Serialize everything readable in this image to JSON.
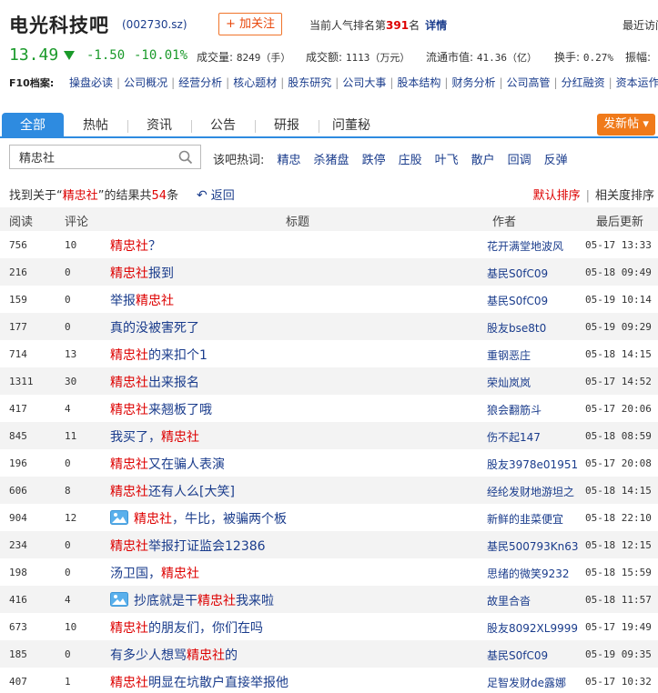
{
  "header": {
    "stock_name": "电光科技吧",
    "stock_code": "(002730.sz)",
    "follow_label": "+ 加关注",
    "rank_prefix": "当前人气排名第",
    "rank_value": "391",
    "rank_suffix": "名",
    "detail_label": "详情",
    "recent_label": "最近访问"
  },
  "quote": {
    "price": "13.49",
    "change": "-1.50",
    "change_pct": "-10.01%",
    "volume_label": "成交量:",
    "volume_value": "8249（手）",
    "turnover_label": "成交额:",
    "turnover_value": "1113（万元）",
    "float_cap_label": "流通市值:",
    "float_cap_value": "41.36（亿）",
    "turnover_rate_label": "换手:",
    "turnover_rate_value": "0.27%",
    "amplitude_label": "振幅:"
  },
  "f10": {
    "label": "F10档案:",
    "links": [
      "操盘必读",
      "公司概况",
      "经营分析",
      "核心题材",
      "股东研究",
      "公司大事",
      "股本结构",
      "财务分析",
      "公司高管",
      "分红融资",
      "资本运作"
    ]
  },
  "tabs": [
    "全部",
    "热帖",
    "资讯",
    "公告",
    "研报",
    "问董秘"
  ],
  "post_button": "发新帖",
  "search": {
    "value": "精忠社",
    "hot_label": "该吧热词:",
    "hot_words": [
      "精忠",
      "杀猪盘",
      "跌停",
      "庄股",
      "叶飞",
      "散户",
      "回调",
      "反弹"
    ]
  },
  "result": {
    "prefix": "找到关于“",
    "keyword": "精忠社",
    "middle": "”的结果共",
    "count": "54",
    "suffix": "条",
    "back_label": "返回",
    "sort_default": "默认排序",
    "sort_relevance": "相关度排序"
  },
  "columns": {
    "read": "阅读",
    "comment": "评论",
    "title": "标题",
    "author": "作者",
    "updated": "最后更新"
  },
  "posts": [
    {
      "read": "756",
      "comment": "10",
      "pre": "",
      "hl": "精忠社",
      "post": "？",
      "image": false,
      "author": "花开满堂地波风",
      "time": "05-17 13:33"
    },
    {
      "read": "216",
      "comment": "0",
      "pre": "",
      "hl": "精忠社",
      "post": "报到",
      "image": false,
      "author": "基民S0fC09",
      "time": "05-18 09:49"
    },
    {
      "read": "159",
      "comment": "0",
      "pre": "举报",
      "hl": "精忠社",
      "post": "",
      "image": false,
      "author": "基民S0fC09",
      "time": "05-19 10:14"
    },
    {
      "read": "177",
      "comment": "0",
      "pre": "真的没被害死了",
      "hl": "",
      "post": "",
      "image": false,
      "author": "股友bse8t0",
      "time": "05-19 09:29"
    },
    {
      "read": "714",
      "comment": "13",
      "pre": "",
      "hl": "精忠社",
      "post": "的来扣个1",
      "image": false,
      "author": "重钢恶庄",
      "time": "05-18 14:15"
    },
    {
      "read": "1311",
      "comment": "30",
      "pre": "",
      "hl": "精忠社",
      "post": "出来报名",
      "image": false,
      "author": "荣灿岚岚",
      "time": "05-17 14:52"
    },
    {
      "read": "417",
      "comment": "4",
      "pre": "",
      "hl": "精忠社",
      "post": "来翘板了哦",
      "image": false,
      "author": "狼会翻筋斗",
      "time": "05-17 20:06"
    },
    {
      "read": "845",
      "comment": "11",
      "pre": "我买了，",
      "hl": "精忠社",
      "post": "",
      "image": false,
      "author": "伤不起147",
      "time": "05-18 08:59"
    },
    {
      "read": "196",
      "comment": "0",
      "pre": "",
      "hl": "精忠社",
      "post": "又在骗人表演",
      "image": false,
      "author": "股友3978e01951",
      "time": "05-17 20:08"
    },
    {
      "read": "606",
      "comment": "8",
      "pre": "",
      "hl": "精忠社",
      "post": "还有人么[大笑]",
      "image": false,
      "author": "经纶发财地游坦之",
      "time": "05-18 14:15"
    },
    {
      "read": "904",
      "comment": "12",
      "pre": "",
      "hl": "精忠社",
      "post": "，牛比，被骗两个板",
      "image": true,
      "author": "新鲜的韭菜便宜",
      "time": "05-18 22:10"
    },
    {
      "read": "234",
      "comment": "0",
      "pre": "",
      "hl": "精忠社",
      "post": "举报打证监会12386",
      "image": false,
      "author": "基民500793Kn63",
      "time": "05-18 12:15"
    },
    {
      "read": "198",
      "comment": "0",
      "pre": "汤卫国，",
      "hl": "精忠社",
      "post": "",
      "image": false,
      "author": "思绪的微笑9232",
      "time": "05-18 15:59"
    },
    {
      "read": "416",
      "comment": "4",
      "pre": "抄底就是干",
      "hl": "精忠社",
      "post": "我来啦",
      "image": true,
      "author": "故里合沓",
      "time": "05-18 11:57"
    },
    {
      "read": "673",
      "comment": "10",
      "pre": "",
      "hl": "精忠社",
      "post": "的朋友们，你们在吗",
      "image": false,
      "author": "股友8092XL9999",
      "time": "05-17 19:49"
    },
    {
      "read": "185",
      "comment": "0",
      "pre": "有多少人想骂",
      "hl": "精忠社",
      "post": "的",
      "image": false,
      "author": "基民S0fC09",
      "time": "05-19 09:35"
    },
    {
      "read": "407",
      "comment": "1",
      "pre": "",
      "hl": "精忠社",
      "post": "明显在坑散户直接举报他",
      "image": false,
      "author": "足智发财de露娜",
      "time": "05-17 10:32"
    }
  ]
}
